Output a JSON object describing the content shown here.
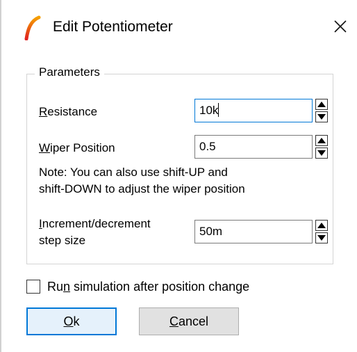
{
  "window": {
    "title": "Edit Potentiometer",
    "app_icon": "ltspice-logo-icon",
    "close_icon": "close-icon"
  },
  "parameters": {
    "group_title": "Parameters",
    "resistance": {
      "label_mnemonic": "R",
      "label_rest": "esistance",
      "value": "10k"
    },
    "wiper_position": {
      "label_mnemonic": "W",
      "label_rest": "iper Position",
      "value": "0.5"
    },
    "note_line1": "Note: You can also use shift-UP and",
    "note_line2": "shift-DOWN to adjust the wiper position",
    "step_size": {
      "label_mnemonic": "I",
      "label_rest_line1": "ncrement/decrement",
      "label_line2": "step size",
      "value": "50m"
    }
  },
  "run_simulation": {
    "label_before": "Ru",
    "label_mnemonic": "n",
    "label_after": " simulation after position change",
    "checked": false
  },
  "buttons": {
    "ok_mnemonic": "O",
    "ok_rest": "k",
    "cancel_mnemonic": "C",
    "cancel_rest": "ancel"
  },
  "colors": {
    "focus_accent": "#0078d7",
    "button_face": "#e1e1e1",
    "icon_red": "#e02020",
    "icon_orange": "#f5a000"
  }
}
